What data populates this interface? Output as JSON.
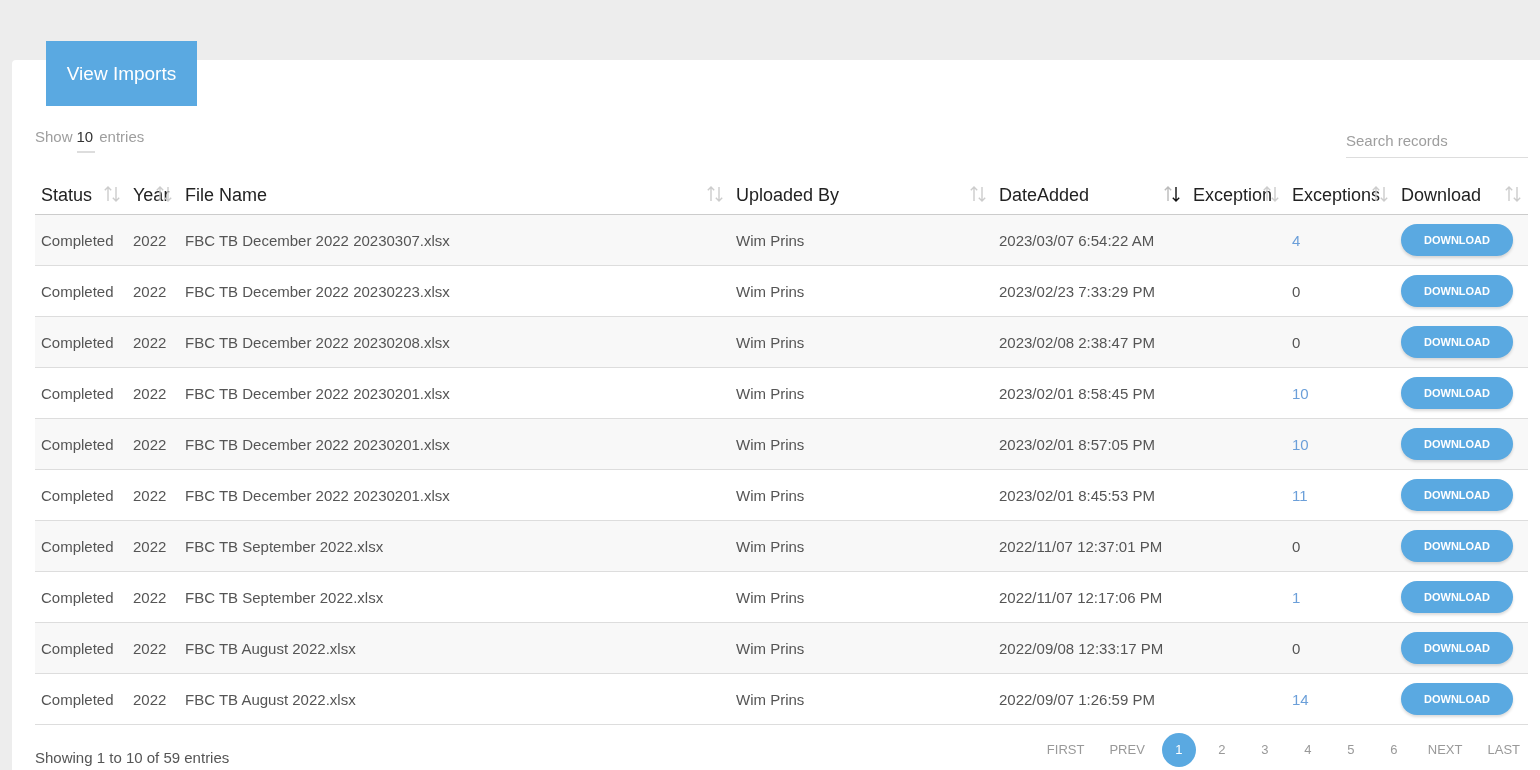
{
  "header_button": "View Imports",
  "length_control": {
    "prefix": "Show",
    "value": "10",
    "suffix": "entries"
  },
  "search": {
    "placeholder": "Search records"
  },
  "table": {
    "columns": [
      {
        "label": "Status",
        "sorted": false
      },
      {
        "label": "Year",
        "sorted": false
      },
      {
        "label": "File Name",
        "sorted": false
      },
      {
        "label": "Uploaded By",
        "sorted": false
      },
      {
        "label": "DateAdded",
        "sorted": true
      },
      {
        "label": "Exception",
        "sorted": false
      },
      {
        "label": "Exceptions",
        "sorted": false
      },
      {
        "label": "Download",
        "sorted": false
      }
    ],
    "rows": [
      {
        "status": "Completed",
        "year": "2022",
        "file_name": "FBC TB December 2022 20230307.xlsx",
        "uploaded_by": "Wim Prins",
        "date_added": "2023/03/07 6:54:22 AM",
        "exceptions": "4",
        "exceptions_link": true,
        "download": "DOWNLOAD"
      },
      {
        "status": "Completed",
        "year": "2022",
        "file_name": "FBC TB December 2022 20230223.xlsx",
        "uploaded_by": "Wim Prins",
        "date_added": "2023/02/23 7:33:29 PM",
        "exceptions": "0",
        "exceptions_link": false,
        "download": "DOWNLOAD"
      },
      {
        "status": "Completed",
        "year": "2022",
        "file_name": "FBC TB December 2022 20230208.xlsx",
        "uploaded_by": "Wim Prins",
        "date_added": "2023/02/08 2:38:47 PM",
        "exceptions": "0",
        "exceptions_link": false,
        "download": "DOWNLOAD"
      },
      {
        "status": "Completed",
        "year": "2022",
        "file_name": "FBC TB December 2022 20230201.xlsx",
        "uploaded_by": "Wim Prins",
        "date_added": "2023/02/01 8:58:45 PM",
        "exceptions": "10",
        "exceptions_link": true,
        "download": "DOWNLOAD"
      },
      {
        "status": "Completed",
        "year": "2022",
        "file_name": "FBC TB December 2022 20230201.xlsx",
        "uploaded_by": "Wim Prins",
        "date_added": "2023/02/01 8:57:05 PM",
        "exceptions": "10",
        "exceptions_link": true,
        "download": "DOWNLOAD"
      },
      {
        "status": "Completed",
        "year": "2022",
        "file_name": "FBC TB December 2022 20230201.xlsx",
        "uploaded_by": "Wim Prins",
        "date_added": "2023/02/01 8:45:53 PM",
        "exceptions": "11",
        "exceptions_link": true,
        "download": "DOWNLOAD"
      },
      {
        "status": "Completed",
        "year": "2022",
        "file_name": "FBC TB September 2022.xlsx",
        "uploaded_by": "Wim Prins",
        "date_added": "2022/11/07 12:37:01 PM",
        "exceptions": "0",
        "exceptions_link": false,
        "download": "DOWNLOAD"
      },
      {
        "status": "Completed",
        "year": "2022",
        "file_name": "FBC TB September 2022.xlsx",
        "uploaded_by": "Wim Prins",
        "date_added": "2022/11/07 12:17:06 PM",
        "exceptions": "1",
        "exceptions_link": true,
        "download": "DOWNLOAD"
      },
      {
        "status": "Completed",
        "year": "2022",
        "file_name": "FBC TB August 2022.xlsx",
        "uploaded_by": "Wim Prins",
        "date_added": "2022/09/08 12:33:17 PM",
        "exceptions": "0",
        "exceptions_link": false,
        "download": "DOWNLOAD"
      },
      {
        "status": "Completed",
        "year": "2022",
        "file_name": "FBC TB August 2022.xlsx",
        "uploaded_by": "Wim Prins",
        "date_added": "2022/09/07 1:26:59 PM",
        "exceptions": "14",
        "exceptions_link": true,
        "download": "DOWNLOAD"
      }
    ]
  },
  "info": "Showing 1 to 10 of 59 entries",
  "pagination": {
    "first": "FIRST",
    "prev": "PREV",
    "pages": [
      {
        "label": "1",
        "selected": true
      },
      {
        "label": "2",
        "selected": false
      },
      {
        "label": "3",
        "selected": false
      },
      {
        "label": "4",
        "selected": false
      },
      {
        "label": "5",
        "selected": false
      },
      {
        "label": "6",
        "selected": false
      }
    ],
    "next": "NEXT",
    "last": "LAST"
  }
}
